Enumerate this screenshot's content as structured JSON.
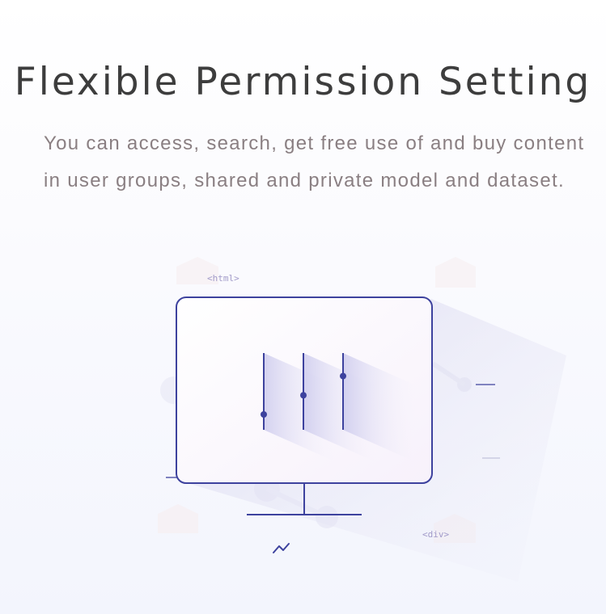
{
  "header": {
    "title": "Flexible Permission Setting",
    "description": "You can access, search, get free use of and buy content in user groups, shared and private model and dataset."
  },
  "illustration": {
    "tag_html": "<html>",
    "tag_div": "<div>",
    "slider_levels": [
      0.2,
      0.45,
      0.7
    ],
    "colors": {
      "line": "#3d429e",
      "accent_light": "#dcdcf3",
      "screen_fill": "#fbf8fe"
    },
    "icons": [
      "monitor-icon",
      "sliders-icon",
      "trend-line-icon"
    ]
  }
}
